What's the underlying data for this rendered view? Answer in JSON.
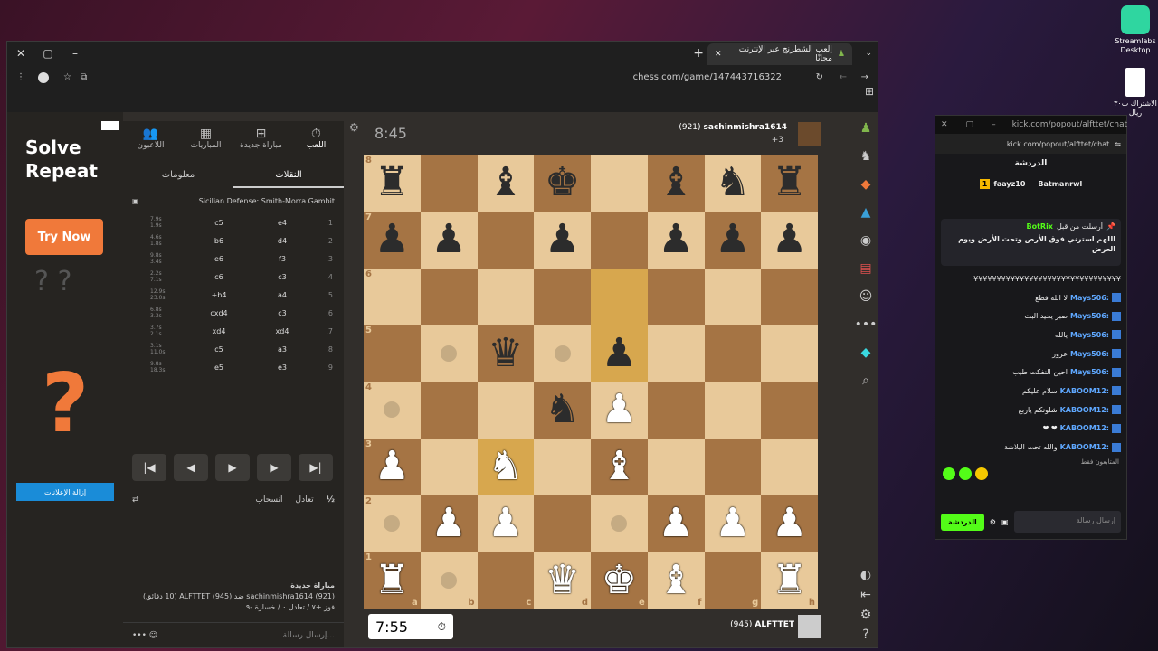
{
  "desktop": {
    "streamlabs": "Streamlabs Desktop",
    "file": "الاشتراك ب٣٠ ريال"
  },
  "browser": {
    "tab_title": "إلعب الشطرنج عبر الإنترنت مجانًا",
    "url": "chess.com/game/147443716322"
  },
  "ad": {
    "headline": "Solve Repeat",
    "cta": "Try Now",
    "remove": "إزالة الإعلانات"
  },
  "panel": {
    "tabs": [
      "اللعب",
      "مباراة جديدة",
      "المباريات",
      "اللاعبون"
    ],
    "subtabs": [
      "النقلات",
      "معلومات"
    ],
    "opening": "Sicilian Defense: Smith-Morra Gambit",
    "moves": [
      {
        "n": "1.",
        "w": "e4",
        "b": "c5",
        "t": "7.9s\n1.9s"
      },
      {
        "n": "2.",
        "w": "d4",
        "b": "b6",
        "t": "4.6s\n1.8s"
      },
      {
        "n": "3.",
        "w": "f3",
        "b": "e6",
        "t": "9.8s\n3.4s"
      },
      {
        "n": "4.",
        "w": "c3",
        "b": "c6",
        "t": "2.2s\n7.1s"
      },
      {
        "n": "5.",
        "w": "a4",
        "b": "b4+",
        "t": "12.9s\n23.0s"
      },
      {
        "n": "6.",
        "w": "c3",
        "b": "cxd4",
        "t": "6.8s\n3.3s"
      },
      {
        "n": "7.",
        "w": "xd4",
        "b": "xd4",
        "t": "3.7s\n2.1s"
      },
      {
        "n": "8.",
        "w": "a3",
        "b": "c5",
        "t": "3.1s\n11.0s"
      },
      {
        "n": "9.",
        "w": "e3",
        "b": "e5",
        "t": "9.8s\n18.3s"
      }
    ],
    "draw": "تعادل",
    "resign": "انسحاب",
    "half": "½",
    "game_info_title": "مباراة جديدة",
    "game_info": "sachinmishra1614 (921) ضد ALFTTET (945) (10 دقائق)",
    "game_stats": "فوز +٧ / تعادل ٠ / خسارة -٩",
    "chat_placeholder": "إرسال رسالة..."
  },
  "top_player": {
    "name": "sachinmishra1614",
    "rating": "(921)",
    "clock": "8:45",
    "material": "+3"
  },
  "bottom_player": {
    "name": "ALFTTET",
    "rating": "(945)",
    "clock": "7:55"
  },
  "board": {
    "rows": [
      [
        "br",
        "",
        "bb",
        "bk",
        "",
        "bb",
        "bn",
        "br"
      ],
      [
        "bp",
        "bp",
        "",
        "bp",
        "",
        "bp",
        "bp",
        "bp"
      ],
      [
        "",
        "",
        "",
        "",
        "",
        "",
        "",
        ""
      ],
      [
        "",
        "",
        "bq",
        "",
        "bp",
        "",
        "",
        ""
      ],
      [
        "",
        "",
        "",
        "bn",
        "wp",
        "",
        "",
        ""
      ],
      [
        "wp",
        "",
        "wn",
        "",
        "wb",
        "",
        "",
        ""
      ],
      [
        "",
        "wp",
        "wp",
        "",
        "",
        "wp",
        "wp",
        "wp"
      ],
      [
        "wr",
        "",
        "",
        "wq",
        "wk",
        "wb",
        "",
        "wr"
      ]
    ],
    "highlights": [
      "e6",
      "e5",
      "c3"
    ],
    "dots": [
      "b5",
      "d5",
      "a4",
      "a2",
      "e2",
      "b1"
    ],
    "ranks": [
      "8",
      "7",
      "6",
      "5",
      "4",
      "3",
      "2",
      "1"
    ],
    "files": [
      "a",
      "b",
      "c",
      "d",
      "e",
      "f",
      "g",
      "h"
    ]
  },
  "kick": {
    "url": "kick.com/popout/alfttet/chat",
    "title": "الدردشة",
    "leaders": [
      "Batmanrwl",
      "faayz10"
    ],
    "pinned_user": "BotRix",
    "pinned_label": "أرسلت من قبل",
    "pinned_msg": "اللهم استرني فوق الأرض وتحت الأرض ويوم العرض",
    "messages": [
      {
        "u": "",
        "m": "¥¥¥¥¥¥¥¥¥¥¥¥¥¥¥¥¥¥¥¥¥¥¥¥¥¥¥¥¥¥¥¥"
      },
      {
        "u": "Mays506:",
        "m": "لا الله فطع"
      },
      {
        "u": "Mays506:",
        "m": "صبر يحيد البث"
      },
      {
        "u": "Mays506:",
        "m": "يالله"
      },
      {
        "u": "Mays506:",
        "m": "عرور"
      },
      {
        "u": "Mays506:",
        "m": "احين النفكت طيب"
      },
      {
        "u": "KABOOM12:",
        "m": "سلام عليكم"
      },
      {
        "u": "KABOOM12:",
        "m": "شلونكم ياربع"
      },
      {
        "u": "KABOOM12:",
        "m": "❤ ❤"
      },
      {
        "u": "KABOOM12:",
        "m": "والله تحت البلاشة"
      }
    ],
    "followers_only": "المتابعون فقط",
    "input_placeholder": "إرسال رسالة",
    "send": "الدردشة"
  }
}
